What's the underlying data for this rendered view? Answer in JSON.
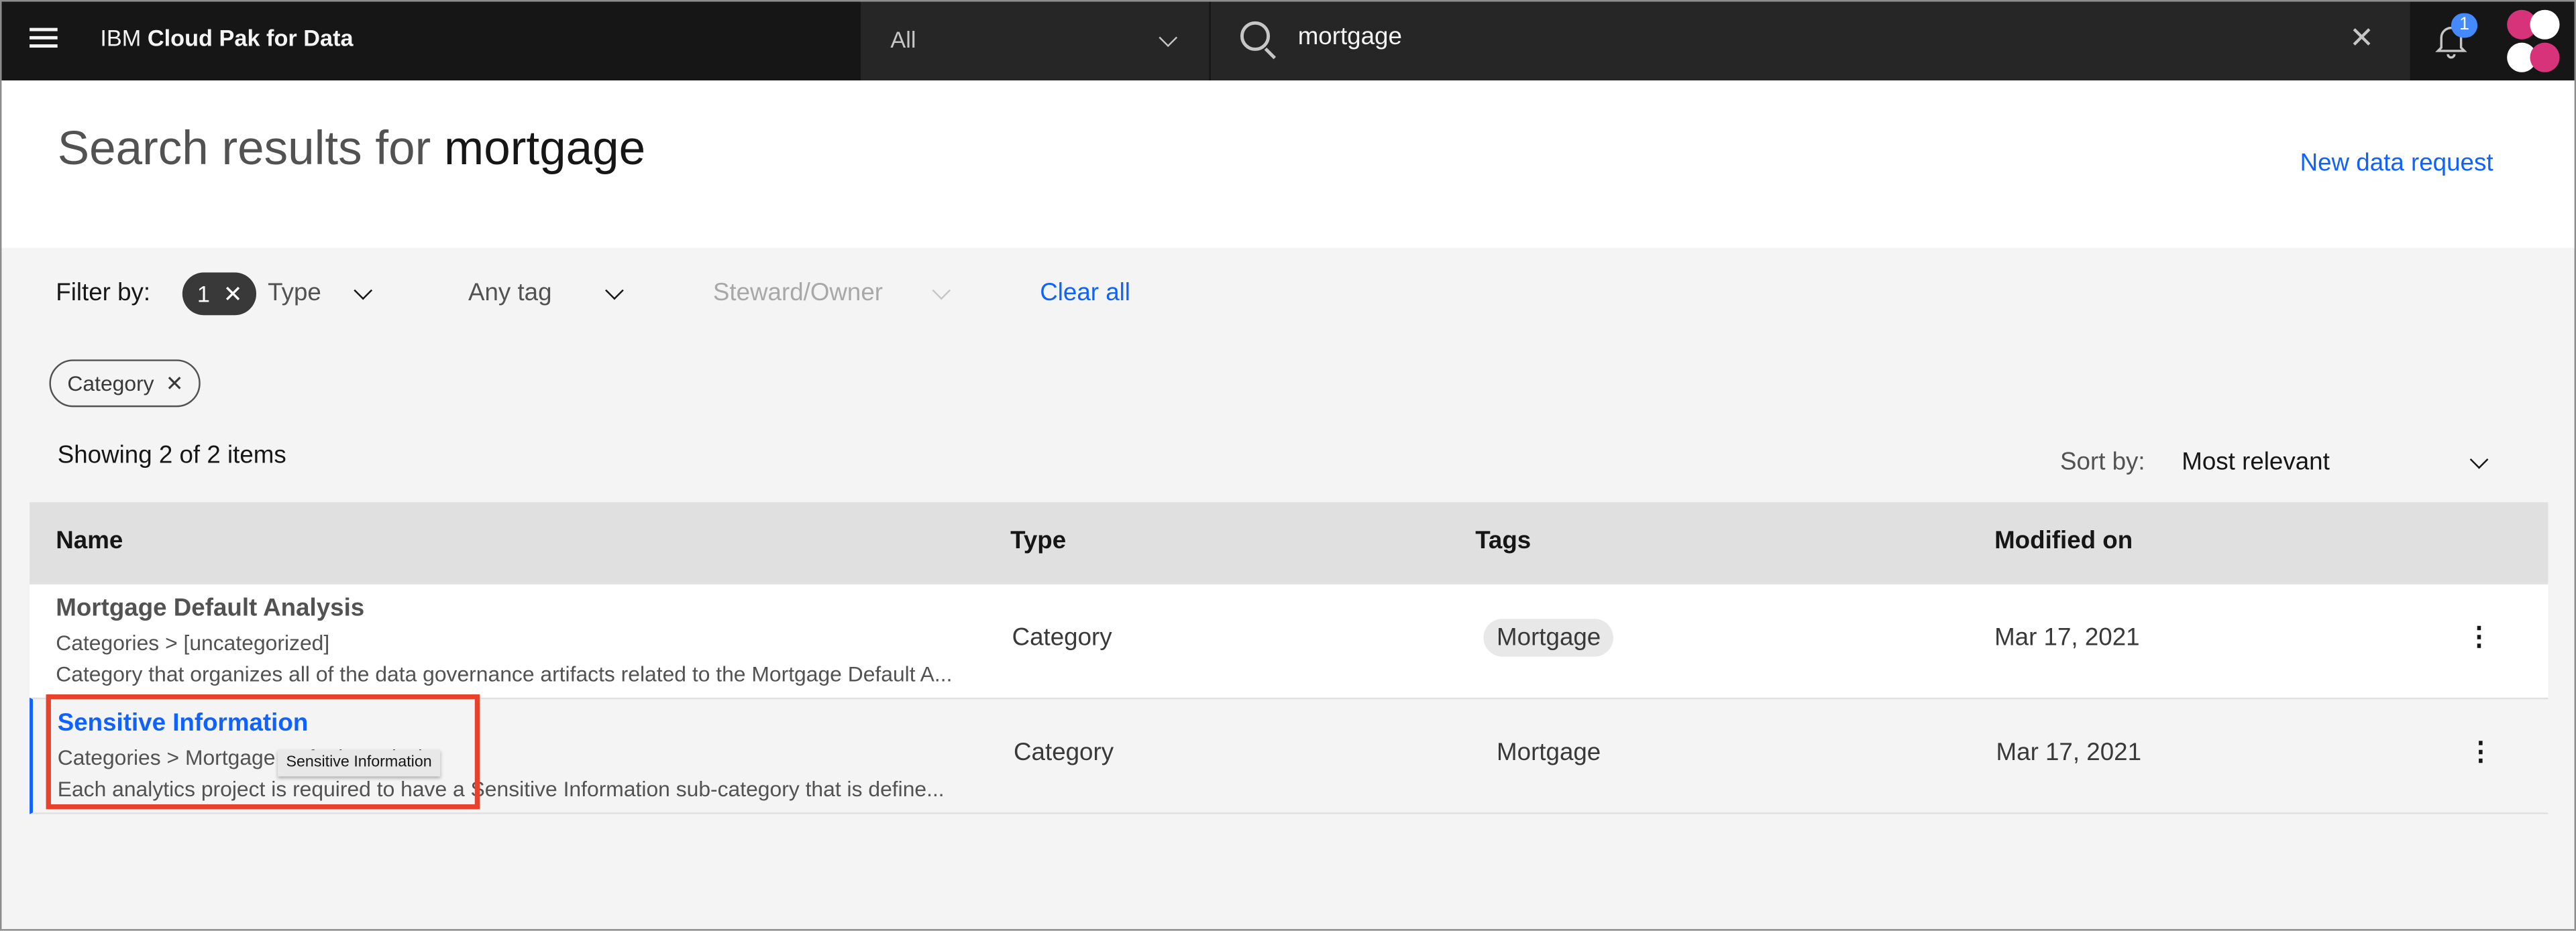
{
  "header": {
    "brand_prefix": "IBM",
    "brand_name": "Cloud Pak for Data",
    "scope_selected": "All",
    "search_value": "mortgage",
    "notification_count": "1",
    "icons": [
      "menu-icon",
      "chevron-down-icon",
      "search-icon",
      "close-icon",
      "notification-icon",
      "avatar"
    ]
  },
  "page": {
    "title_prefix": "Search results for",
    "title_query": "mortgage",
    "new_request_label": "New data request"
  },
  "filters": {
    "label": "Filter by:",
    "type_count": "1",
    "type_label": "Type",
    "tag_label": "Any tag",
    "steward_label": "Steward/Owner",
    "clear_label": "Clear all",
    "active_tag": "Category"
  },
  "results": {
    "summary": "Showing 2 of 2 items",
    "sort_label": "Sort by:",
    "sort_value": "Most relevant",
    "columns": [
      "Name",
      "Type",
      "Tags",
      "Modified on"
    ],
    "rows": [
      {
        "name": "Mortgage Default Analysis",
        "path": "Categories > [uncategorized]",
        "description": "Category that organizes all of the data governance artifacts related to the Mortgage Default A...",
        "type": "Category",
        "tag": "Mortgage",
        "modified": "Mar 17, 2021"
      },
      {
        "name": "Sensitive Information",
        "path": "Categories > Mortgage Default Analysis",
        "description": "Each analytics project is required to have a Sensitive Information sub-category that is define...",
        "type": "Category",
        "tag": "Mortgage",
        "modified": "Mar 17, 2021"
      }
    ],
    "tooltip": "Sensitive Information"
  },
  "colors": {
    "accent": "#0f62fe",
    "highlight": "#e8412c",
    "header_bg": "#161616"
  }
}
